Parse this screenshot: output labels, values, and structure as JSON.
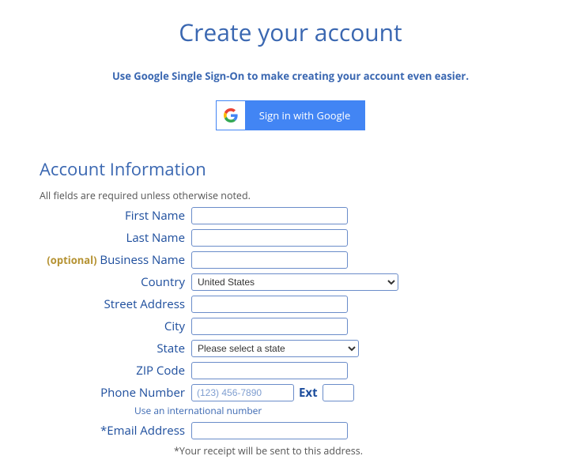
{
  "page": {
    "title": "Create your account",
    "sso_text": "Use Google Single Sign-On to make creating your account even easier.",
    "google_button": "Sign in with Google"
  },
  "section": {
    "title": "Account Information",
    "note": "All fields are required unless otherwise noted."
  },
  "labels": {
    "first_name": "First Name",
    "last_name": "Last Name",
    "optional": "(optional)",
    "business_name": "Business Name",
    "country": "Country",
    "street_address": "Street Address",
    "city": "City",
    "state": "State",
    "zip": "ZIP Code",
    "phone": "Phone Number",
    "ext": "Ext",
    "email": "*Email Address"
  },
  "values": {
    "first_name": "",
    "last_name": "",
    "business_name": "",
    "country_selected": "United States",
    "street_address": "",
    "city": "",
    "state_selected": "Please select a state",
    "zip": "",
    "phone": "",
    "ext": "",
    "email": ""
  },
  "placeholders": {
    "phone": "(123) 456-7890"
  },
  "hints": {
    "intl": "Use an international number",
    "receipt": "*Your receipt will be sent to this address."
  }
}
